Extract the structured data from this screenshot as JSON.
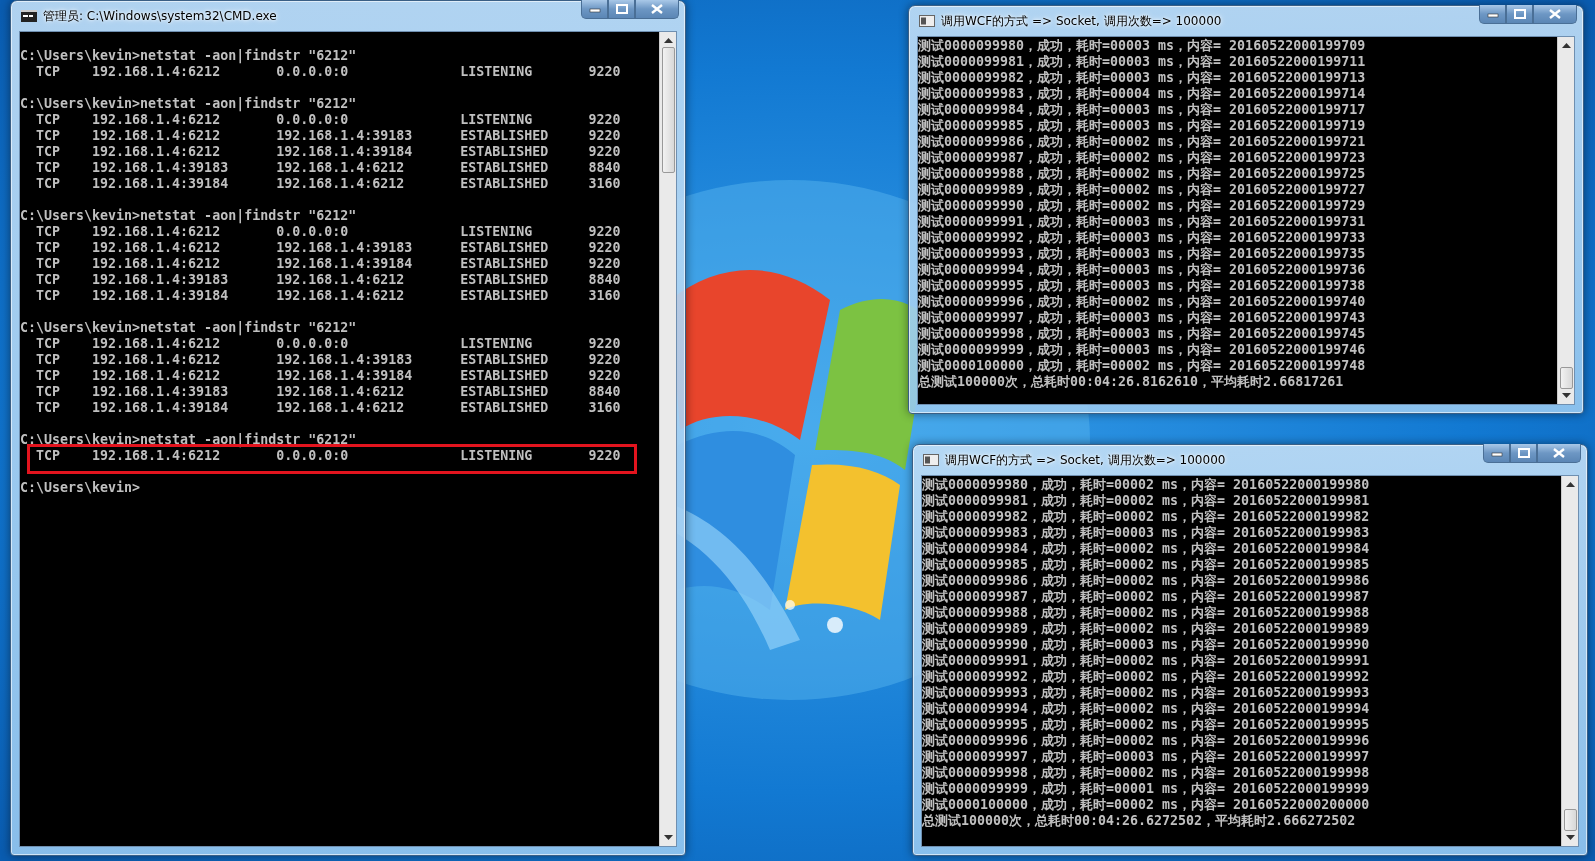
{
  "cmd_window": {
    "title": "管理员: C:\\Windows\\system32\\CMD.exe",
    "blocks": [
      {
        "command": "C:\\Users\\kevin>netstat -aon|findstr \"6212\"",
        "rows": [
          {
            "text": "  TCP    192.168.1.4:6212       0.0.0.0:0              LISTENING       9220",
            "highlighted": false
          }
        ]
      },
      {
        "command": "C:\\Users\\kevin>netstat -aon|findstr \"6212\"",
        "rows": [
          {
            "text": "  TCP    192.168.1.4:6212       0.0.0.0:0              LISTENING       9220",
            "highlighted": false
          },
          {
            "text": "  TCP    192.168.1.4:6212       192.168.1.4:39183      ESTABLISHED     9220",
            "highlighted": false
          },
          {
            "text": "  TCP    192.168.1.4:6212       192.168.1.4:39184      ESTABLISHED     9220",
            "highlighted": false
          },
          {
            "text": "  TCP    192.168.1.4:39183      192.168.1.4:6212       ESTABLISHED     8840",
            "highlighted": false
          },
          {
            "text": "  TCP    192.168.1.4:39184      192.168.1.4:6212       ESTABLISHED     3160",
            "highlighted": false
          }
        ]
      },
      {
        "command": "C:\\Users\\kevin>netstat -aon|findstr \"6212\"",
        "rows": [
          {
            "text": "  TCP    192.168.1.4:6212       0.0.0.0:0              LISTENING       9220",
            "highlighted": false
          },
          {
            "text": "  TCP    192.168.1.4:6212       192.168.1.4:39183      ESTABLISHED     9220",
            "highlighted": false
          },
          {
            "text": "  TCP    192.168.1.4:6212       192.168.1.4:39184      ESTABLISHED     9220",
            "highlighted": false
          },
          {
            "text": "  TCP    192.168.1.4:39183      192.168.1.4:6212       ESTABLISHED     8840",
            "highlighted": false
          },
          {
            "text": "  TCP    192.168.1.4:39184      192.168.1.4:6212       ESTABLISHED     3160",
            "highlighted": false
          }
        ]
      },
      {
        "command": "C:\\Users\\kevin>netstat -aon|findstr \"6212\"",
        "rows": [
          {
            "text": "  TCP    192.168.1.4:6212       0.0.0.0:0              LISTENING       9220",
            "highlighted": false
          },
          {
            "text": "  TCP    192.168.1.4:6212       192.168.1.4:39183      ESTABLISHED     9220",
            "highlighted": false
          },
          {
            "text": "  TCP    192.168.1.4:6212       192.168.1.4:39184      ESTABLISHED     9220",
            "highlighted": false
          },
          {
            "text": "  TCP    192.168.1.4:39183      192.168.1.4:6212       ESTABLISHED     8840",
            "highlighted": false
          },
          {
            "text": "  TCP    192.168.1.4:39184      192.168.1.4:6212       ESTABLISHED     3160",
            "highlighted": false
          }
        ]
      },
      {
        "command": "C:\\Users\\kevin>netstat -aon|findstr \"6212\"",
        "rows": [
          {
            "text": "  TCP    192.168.1.4:6212       0.0.0.0:0              LISTENING       9220",
            "highlighted": true
          }
        ]
      }
    ],
    "prompt": "C:\\Users\\kevin>"
  },
  "client_windows": [
    {
      "title": "调用WCF的方式 => Socket, 调用次数=> 100000",
      "lines": [
        "测试0000099980，成功，耗时=00003 ms，内容= 20160522000199709",
        "测试0000099981，成功，耗时=00003 ms，内容= 20160522000199711",
        "测试0000099982，成功，耗时=00003 ms，内容= 20160522000199713",
        "测试0000099983，成功，耗时=00004 ms，内容= 20160522000199714",
        "测试0000099984，成功，耗时=00003 ms，内容= 20160522000199717",
        "测试0000099985，成功，耗时=00003 ms，内容= 20160522000199719",
        "测试0000099986，成功，耗时=00002 ms，内容= 20160522000199721",
        "测试0000099987，成功，耗时=00002 ms，内容= 20160522000199723",
        "测试0000099988，成功，耗时=00002 ms，内容= 20160522000199725",
        "测试0000099989，成功，耗时=00002 ms，内容= 20160522000199727",
        "测试0000099990，成功，耗时=00002 ms，内容= 20160522000199729",
        "测试0000099991，成功，耗时=00003 ms，内容= 20160522000199731",
        "测试0000099992，成功，耗时=00003 ms，内容= 20160522000199733",
        "测试0000099993，成功，耗时=00003 ms，内容= 20160522000199735",
        "测试0000099994，成功，耗时=00003 ms，内容= 20160522000199736",
        "测试0000099995，成功，耗时=00003 ms，内容= 20160522000199738",
        "测试0000099996，成功，耗时=00002 ms，内容= 20160522000199740",
        "测试0000099997，成功，耗时=00003 ms，内容= 20160522000199743",
        "测试0000099998，成功，耗时=00003 ms，内容= 20160522000199745",
        "测试0000099999，成功，耗时=00003 ms，内容= 20160522000199746",
        "测试0000100000，成功，耗时=00002 ms，内容= 20160522000199748",
        "总测试100000次，总耗时00:04:26.8162610，平均耗时2.66817261"
      ]
    },
    {
      "title": "调用WCF的方式 => Socket, 调用次数=> 100000",
      "lines": [
        "测试0000099980，成功，耗时=00002 ms，内容= 20160522000199980",
        "测试0000099981，成功，耗时=00002 ms，内容= 20160522000199981",
        "测试0000099982，成功，耗时=00002 ms，内容= 20160522000199982",
        "测试0000099983，成功，耗时=00003 ms，内容= 20160522000199983",
        "测试0000099984，成功，耗时=00002 ms，内容= 20160522000199984",
        "测试0000099985，成功，耗时=00002 ms，内容= 20160522000199985",
        "测试0000099986，成功，耗时=00002 ms，内容= 20160522000199986",
        "测试0000099987，成功，耗时=00002 ms，内容= 20160522000199987",
        "测试0000099988，成功，耗时=00002 ms，内容= 20160522000199988",
        "测试0000099989，成功，耗时=00002 ms，内容= 20160522000199989",
        "测试0000099990，成功，耗时=00003 ms，内容= 20160522000199990",
        "测试0000099991，成功，耗时=00002 ms，内容= 20160522000199991",
        "测试0000099992，成功，耗时=00002 ms，内容= 20160522000199992",
        "测试0000099993，成功，耗时=00002 ms，内容= 20160522000199993",
        "测试0000099994，成功，耗时=00002 ms，内容= 20160522000199994",
        "测试0000099995，成功，耗时=00002 ms，内容= 20160522000199995",
        "测试0000099996，成功，耗时=00002 ms，内容= 20160522000199996",
        "测试0000099997，成功，耗时=00003 ms，内容= 20160522000199997",
        "测试0000099998，成功，耗时=00002 ms，内容= 20160522000199998",
        "测试0000099999，成功，耗时=00001 ms，内容= 20160522000199999",
        "测试0000100000，成功，耗时=00002 ms，内容= 20160522000200000",
        "总测试100000次，总耗时00:04:26.6272502，平均耗时2.666272502"
      ]
    }
  ]
}
